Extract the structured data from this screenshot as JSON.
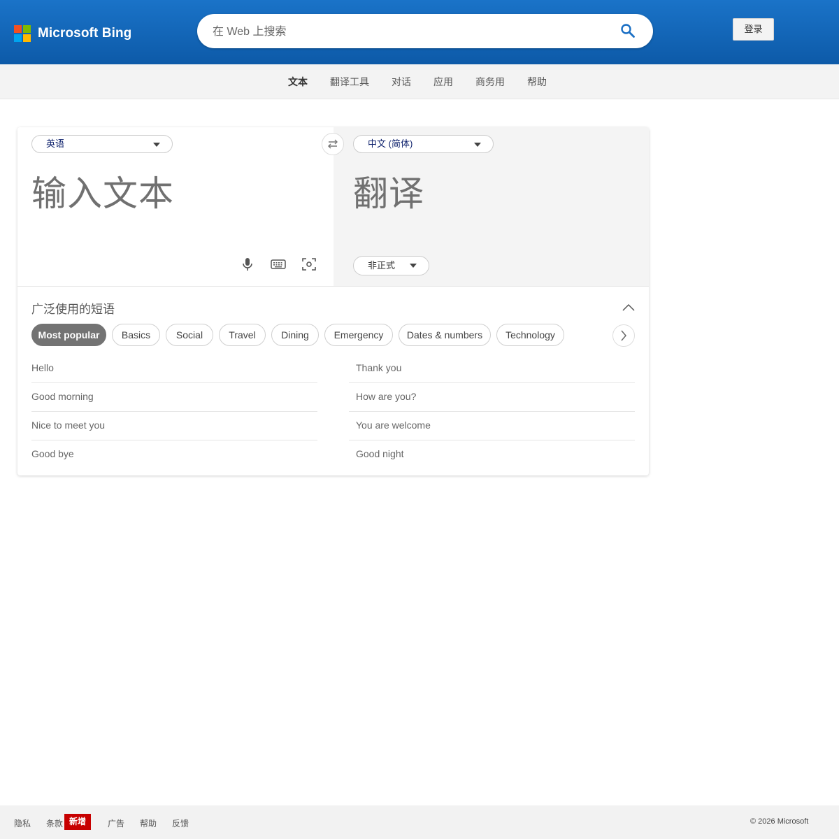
{
  "header": {
    "brand": "Microsoft Bing",
    "search_placeholder": "在 Web 上搜索",
    "signin_label": "登录",
    "logo_colors": [
      "#f25022",
      "#7fba00",
      "#00a4ef",
      "#ffb900"
    ]
  },
  "nav": {
    "items": [
      {
        "label": "文本",
        "active": true
      },
      {
        "label": "翻译工具"
      },
      {
        "label": "对话"
      },
      {
        "label": "应用"
      },
      {
        "label": "商务用"
      },
      {
        "label": "帮助"
      }
    ]
  },
  "translator": {
    "source_lang": "英语",
    "target_lang": "中文 (简体)",
    "input_placeholder": "输入文本",
    "output_placeholder": "翻译",
    "tone": "非正式",
    "icons": [
      "microphone-icon",
      "keyboard-icon",
      "camera-scan-icon",
      "swap-icon"
    ]
  },
  "phrases": {
    "title": "广泛使用的短语",
    "categories": [
      "Most popular",
      "Basics",
      "Social",
      "Travel",
      "Dining",
      "Emergency",
      "Dates & numbers",
      "Technology"
    ],
    "left": [
      "Hello",
      "Good morning",
      "Nice to meet you",
      "Good bye"
    ],
    "right": [
      "Thank you",
      "How are you?",
      "You are welcome",
      "Good night"
    ]
  },
  "footer": {
    "links": [
      "隐私",
      "条款",
      "广告",
      "帮助",
      "反馈"
    ],
    "badge": "新增",
    "copyright": "© 2026 Microsoft"
  },
  "colors": {
    "header_blue": "#0d5aa8",
    "active_chip": "#737373",
    "badge_red": "#c70000"
  }
}
